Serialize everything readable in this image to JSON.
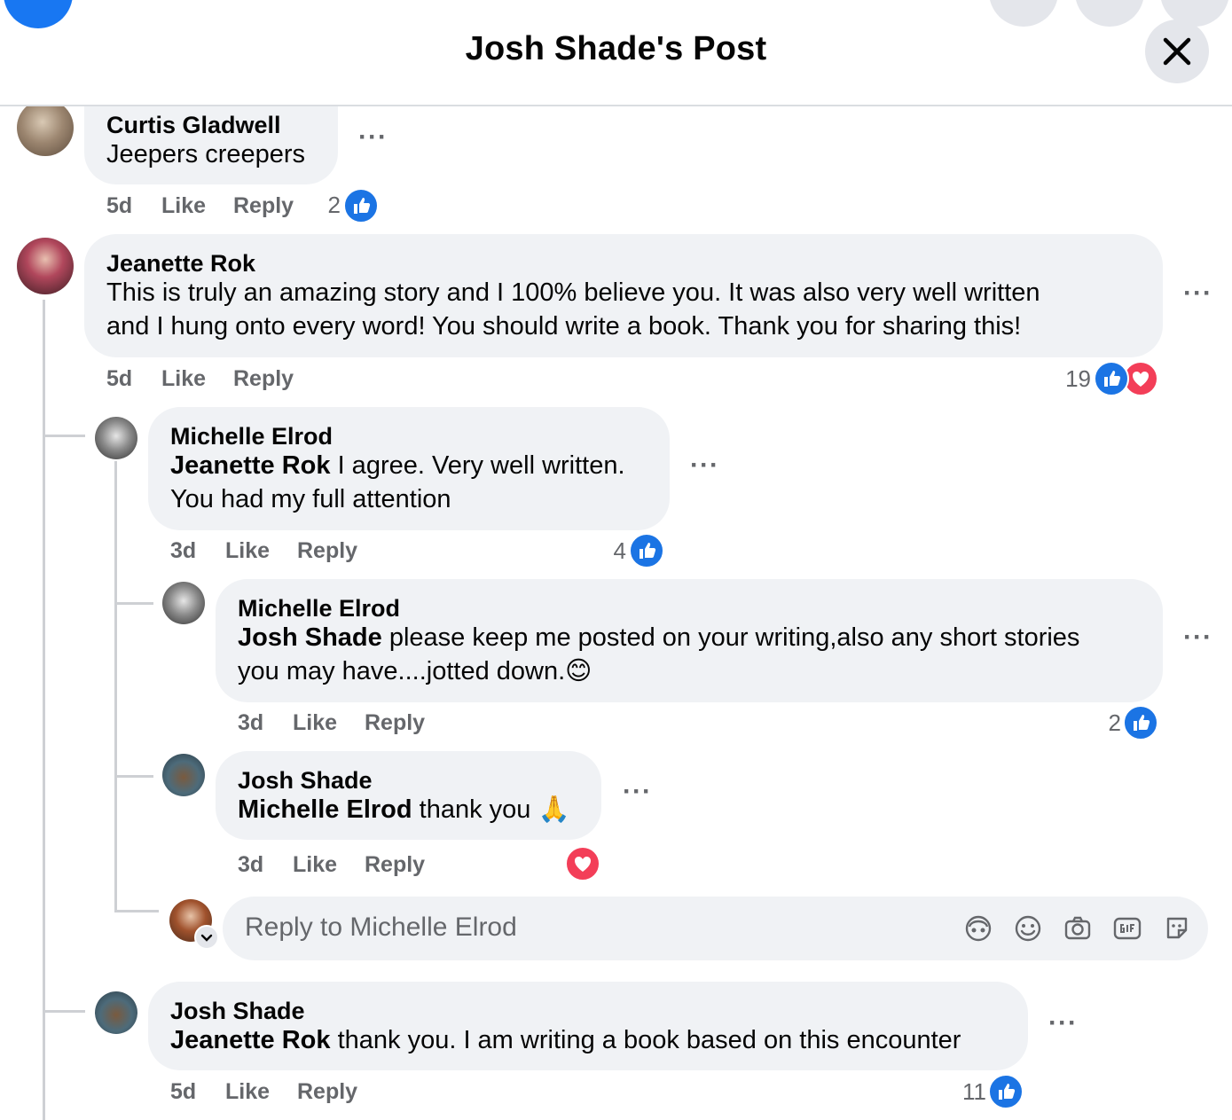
{
  "header": {
    "title": "Josh Shade's Post"
  },
  "comments": [
    {
      "author": "Curtis Gladwell",
      "text": "Jeepers creepers",
      "time": "5d",
      "like_label": "Like",
      "reply_label": "Reply",
      "reaction_count": "2"
    },
    {
      "author": "Jeanette Rok",
      "text_line1": "This is truly an amazing story and I 100% believe you. It was also very well written",
      "text_line2": "and I hung onto every word! You should write a book. Thank you for sharing this!",
      "time": "5d",
      "like_label": "Like",
      "reply_label": "Reply",
      "reaction_count": "19"
    },
    {
      "author": "Michelle Elrod",
      "mention": "Jeanette Rok",
      "text_line1": " I agree. Very well written.",
      "text_line2": "You had my full attention",
      "time": "3d",
      "like_label": "Like",
      "reply_label": "Reply",
      "reaction_count": "4"
    },
    {
      "author": "Michelle Elrod",
      "mention": "Josh Shade",
      "text_line1": " please keep me posted on your writing,also any short stories",
      "text_line2": "you may have....jotted down.",
      "emoji": "😊",
      "time": "3d",
      "like_label": "Like",
      "reply_label": "Reply",
      "reaction_count": "2"
    },
    {
      "author": "Josh Shade",
      "mention": "Michelle Elrod",
      "text_line1": " thank you",
      "emoji": "🙏",
      "time": "3d",
      "like_label": "Like",
      "reply_label": "Reply"
    },
    {
      "author": "Josh Shade",
      "mention": "Jeanette Rok",
      "text_line1": " thank you. I am writing a book based on this encounter",
      "time": "5d",
      "like_label": "Like",
      "reply_label": "Reply",
      "reaction_count": "11"
    }
  ],
  "reply_box": {
    "placeholder": "Reply to Michelle Elrod"
  },
  "more_label": "···",
  "icons": {
    "close": "close-icon",
    "like": "like-reaction-icon",
    "love": "love-reaction-icon",
    "avatar_sticker": "avatar-sticker-icon",
    "emoji": "emoji-icon",
    "camera": "camera-icon",
    "gif": "gif-icon",
    "sticker": "sticker-icon"
  },
  "colors": {
    "accent": "#1b74e4",
    "love": "#f33e58",
    "bubble": "#f0f2f5",
    "meta_text": "#65676b"
  }
}
